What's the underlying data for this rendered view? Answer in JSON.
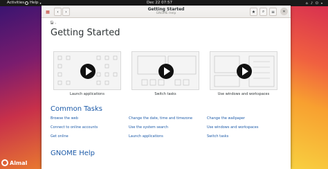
{
  "topbar": {
    "activities": "Activities",
    "help_menu": "Help",
    "clock": "Dec 22  07:57"
  },
  "window": {
    "title": "Getting Started",
    "subtitle": "GNOME Help"
  },
  "content": {
    "page_title": "Getting Started",
    "videos": [
      {
        "caption": "Launch applications"
      },
      {
        "caption": "Switch tasks"
      },
      {
        "caption": "Use windows and workspaces"
      }
    ],
    "common_tasks_title": "Common Tasks",
    "tasks": [
      "Browse the web",
      "Change the date, time and timezone",
      "Change the wallpaper",
      "Connect to online accounts",
      "Use the system search",
      "Use windows and workspaces",
      "Get online",
      "Launch applications",
      "Switch tasks"
    ],
    "gnome_help_title": "GNOME Help"
  },
  "desktop": {
    "logo_text": "Almal"
  }
}
